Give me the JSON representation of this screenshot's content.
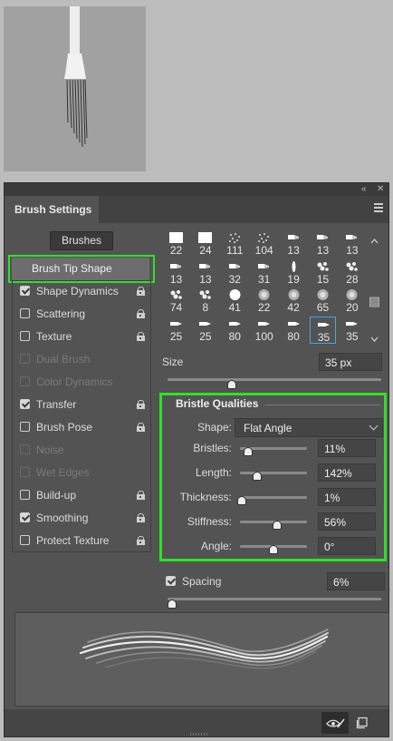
{
  "panel": {
    "tab_title": "Brush Settings",
    "brushes_button": "Brushes",
    "brush_tip_shape_label": "Brush Tip Shape",
    "icons": {
      "collapse": "double-chevron-icon",
      "close": "close-icon",
      "menu": "hamburger-menu-icon"
    }
  },
  "options": [
    {
      "label": "Shape Dynamics",
      "checked": true,
      "enabled": true
    },
    {
      "label": "Scattering",
      "checked": false,
      "enabled": true
    },
    {
      "label": "Texture",
      "checked": false,
      "enabled": true
    },
    {
      "label": "Dual Brush",
      "checked": false,
      "enabled": false
    },
    {
      "label": "Color Dynamics",
      "checked": false,
      "enabled": false
    },
    {
      "label": "Transfer",
      "checked": true,
      "enabled": true
    },
    {
      "label": "Brush Pose",
      "checked": false,
      "enabled": true
    },
    {
      "label": "Noise",
      "checked": false,
      "enabled": false
    },
    {
      "label": "Wet Edges",
      "checked": false,
      "enabled": false
    },
    {
      "label": "Build-up",
      "checked": false,
      "enabled": true
    },
    {
      "label": "Smoothing",
      "checked": true,
      "enabled": true
    },
    {
      "label": "Protect Texture",
      "checked": false,
      "enabled": true
    }
  ],
  "brush_grid": {
    "sizes": [
      "22",
      "24",
      "111",
      "104",
      "13",
      "13",
      "13",
      "13",
      "13",
      "32",
      "31",
      "19",
      "15",
      "28",
      "74",
      "8",
      "41",
      "22",
      "42",
      "65",
      "20",
      "25",
      "25",
      "80",
      "100",
      "80",
      "35",
      "35"
    ],
    "selected_index": 26
  },
  "size": {
    "label": "Size",
    "value": "35 px",
    "slider_fraction": 0.3
  },
  "bristle": {
    "title": "Bristle Qualities",
    "shape_label": "Shape:",
    "shape_value": "Flat Angle",
    "rows": [
      {
        "label": "Bristles:",
        "value": "11%",
        "fraction": 0.1
      },
      {
        "label": "Length:",
        "value": "142%",
        "fraction": 0.24
      },
      {
        "label": "Thickness:",
        "value": "1%",
        "fraction": 0.0
      },
      {
        "label": "Stiffness:",
        "value": "56%",
        "fraction": 0.55
      },
      {
        "label": "Angle:",
        "value": "0°",
        "fraction": 0.5
      }
    ]
  },
  "spacing": {
    "label": "Spacing",
    "value": "6%",
    "checked": true,
    "slider_fraction": 0.02
  },
  "bottom": {
    "icons": [
      "eye-brush-icon",
      "new-preset-icon"
    ]
  },
  "colors": {
    "highlight": "#2fe12a",
    "panel": "#535353",
    "selected_cell": "#4aa3e0"
  }
}
